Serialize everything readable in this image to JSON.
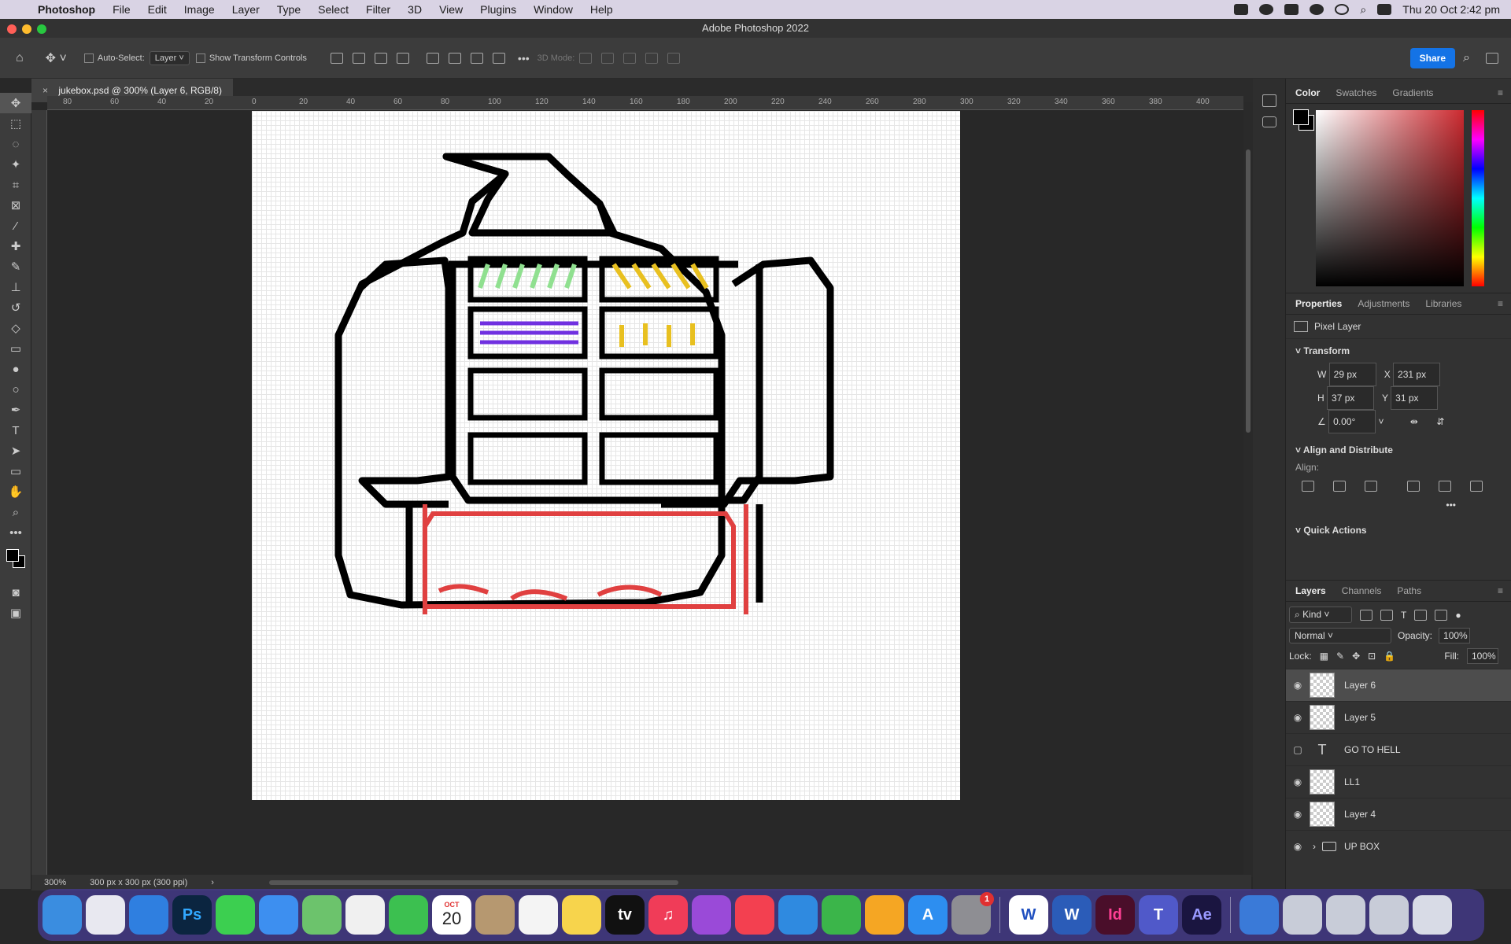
{
  "menubar": {
    "app_name": "Photoshop",
    "menus": [
      "File",
      "Edit",
      "Image",
      "Layer",
      "Type",
      "Select",
      "Filter",
      "3D",
      "View",
      "Plugins",
      "Window",
      "Help"
    ],
    "clock": "Thu 20 Oct  2:42 pm"
  },
  "window": {
    "title": "Adobe Photoshop 2022"
  },
  "options": {
    "auto_select_label": "Auto-Select:",
    "auto_select_value": "Layer",
    "show_transform_label": "Show Transform Controls",
    "mode_3d_label": "3D Mode:",
    "share_label": "Share"
  },
  "document": {
    "tab_title": "jukebox.psd @ 300% (Layer 6, RGB/8)",
    "zoom": "300%",
    "doc_info": "300 px x 300 px (300 ppi)"
  },
  "ruler": {
    "top_ticks": [
      "80",
      "60",
      "40",
      "20",
      "0",
      "20",
      "40",
      "60",
      "80",
      "100",
      "120",
      "140",
      "160",
      "180",
      "200",
      "220",
      "240",
      "260",
      "280",
      "300",
      "320",
      "340",
      "360",
      "380",
      "400"
    ]
  },
  "color_panel": {
    "tabs": [
      "Color",
      "Swatches",
      "Gradients"
    ],
    "fg_color": "#000000",
    "bg_color": "#ffffff",
    "picker_hue": "#cc2a30"
  },
  "properties_panel": {
    "tabs": [
      "Properties",
      "Adjustments",
      "Libraries"
    ],
    "layer_type": "Pixel Layer",
    "transform_title": "Transform",
    "w_label": "W",
    "w_value": "29 px",
    "h_label": "H",
    "h_value": "37 px",
    "x_label": "X",
    "x_value": "231 px",
    "y_label": "Y",
    "y_value": "31 px",
    "angle_value": "0.00°",
    "align_title": "Align and Distribute",
    "align_label": "Align:",
    "quick_actions_title": "Quick Actions"
  },
  "layers_panel": {
    "tabs": [
      "Layers",
      "Channels",
      "Paths"
    ],
    "kind_label": "Kind",
    "blend_mode": "Normal",
    "opacity_label": "Opacity:",
    "opacity_value": "100%",
    "lock_label": "Lock:",
    "fill_label": "Fill:",
    "fill_value": "100%",
    "layers": [
      {
        "name": "Layer 6",
        "kind": "pixel",
        "visible": true,
        "selected": true
      },
      {
        "name": "Layer 5",
        "kind": "pixel",
        "visible": true,
        "selected": false
      },
      {
        "name": "GO TO HELL",
        "kind": "type",
        "visible": false,
        "selected": false
      },
      {
        "name": "LL1",
        "kind": "pixel",
        "visible": true,
        "selected": false
      },
      {
        "name": "Layer 4",
        "kind": "pixel",
        "visible": true,
        "selected": false
      },
      {
        "name": "UP BOX",
        "kind": "group",
        "visible": true,
        "selected": false
      }
    ]
  },
  "dock": {
    "calendar_month": "OCT",
    "calendar_day": "20",
    "settings_badge": "1",
    "apps": [
      {
        "label": "",
        "icon": "finder-icon",
        "color": "#3a8de0"
      },
      {
        "label": "",
        "icon": "launchpad-icon",
        "color": "#e8e8f0"
      },
      {
        "label": "",
        "icon": "safari-icon",
        "color": "#2f7fe0"
      },
      {
        "label": "Ps",
        "icon": "photoshop-icon",
        "color": "#0b2540"
      },
      {
        "label": "",
        "icon": "messages-icon",
        "color": "#3ccf50"
      },
      {
        "label": "",
        "icon": "mail-icon",
        "color": "#3d8ff0"
      },
      {
        "label": "",
        "icon": "maps-icon",
        "color": "#6cc36c"
      },
      {
        "label": "",
        "icon": "photos-icon",
        "color": "#f0f0f0"
      },
      {
        "label": "",
        "icon": "facetime-icon",
        "color": "#3cc050"
      },
      {
        "label": "",
        "icon": "calendar-icon",
        "color": "#ffffff"
      },
      {
        "label": "",
        "icon": "contacts-icon",
        "color": "#b69870"
      },
      {
        "label": "",
        "icon": "reminders-icon",
        "color": "#f4f4f4"
      },
      {
        "label": "",
        "icon": "notes-icon",
        "color": "#f7d44c"
      },
      {
        "label": "tv",
        "icon": "appletv-icon",
        "color": "#111111"
      },
      {
        "label": "♫",
        "icon": "music-icon",
        "color": "#f03c58"
      },
      {
        "label": "",
        "icon": "podcasts-icon",
        "color": "#9a4ad8"
      },
      {
        "label": "",
        "icon": "news-icon",
        "color": "#f34050"
      },
      {
        "label": "",
        "icon": "keynote-icon",
        "color": "#2f8ae0"
      },
      {
        "label": "",
        "icon": "numbers-icon",
        "color": "#3bb54a"
      },
      {
        "label": "",
        "icon": "pages-icon",
        "color": "#f5a623"
      },
      {
        "label": "A",
        "icon": "appstore-icon",
        "color": "#2d8ef0"
      },
      {
        "label": "",
        "icon": "system-settings-icon",
        "color": "#8e8e93"
      },
      {
        "label": "W",
        "icon": "wps-icon",
        "color": "#ffffff"
      },
      {
        "label": "W",
        "icon": "word-icon",
        "color": "#2b5cb8"
      },
      {
        "label": "Id",
        "icon": "indesign-icon",
        "color": "#4a0e2a"
      },
      {
        "label": "T",
        "icon": "teams-icon",
        "color": "#5059c9"
      },
      {
        "label": "Ae",
        "icon": "aftereffects-icon",
        "color": "#1a1540"
      },
      {
        "label": "",
        "icon": "globe-icon",
        "color": "#3a7ad8"
      },
      {
        "label": "",
        "icon": "screenshot-stack-icon",
        "color": "#c8ccd8"
      },
      {
        "label": "",
        "icon": "document-stack-icon",
        "color": "#c8ccd8"
      },
      {
        "label": "",
        "icon": "files-stack-icon",
        "color": "#c8ccd8"
      },
      {
        "label": "",
        "icon": "trash-icon",
        "color": "#d8dbe6"
      }
    ]
  }
}
